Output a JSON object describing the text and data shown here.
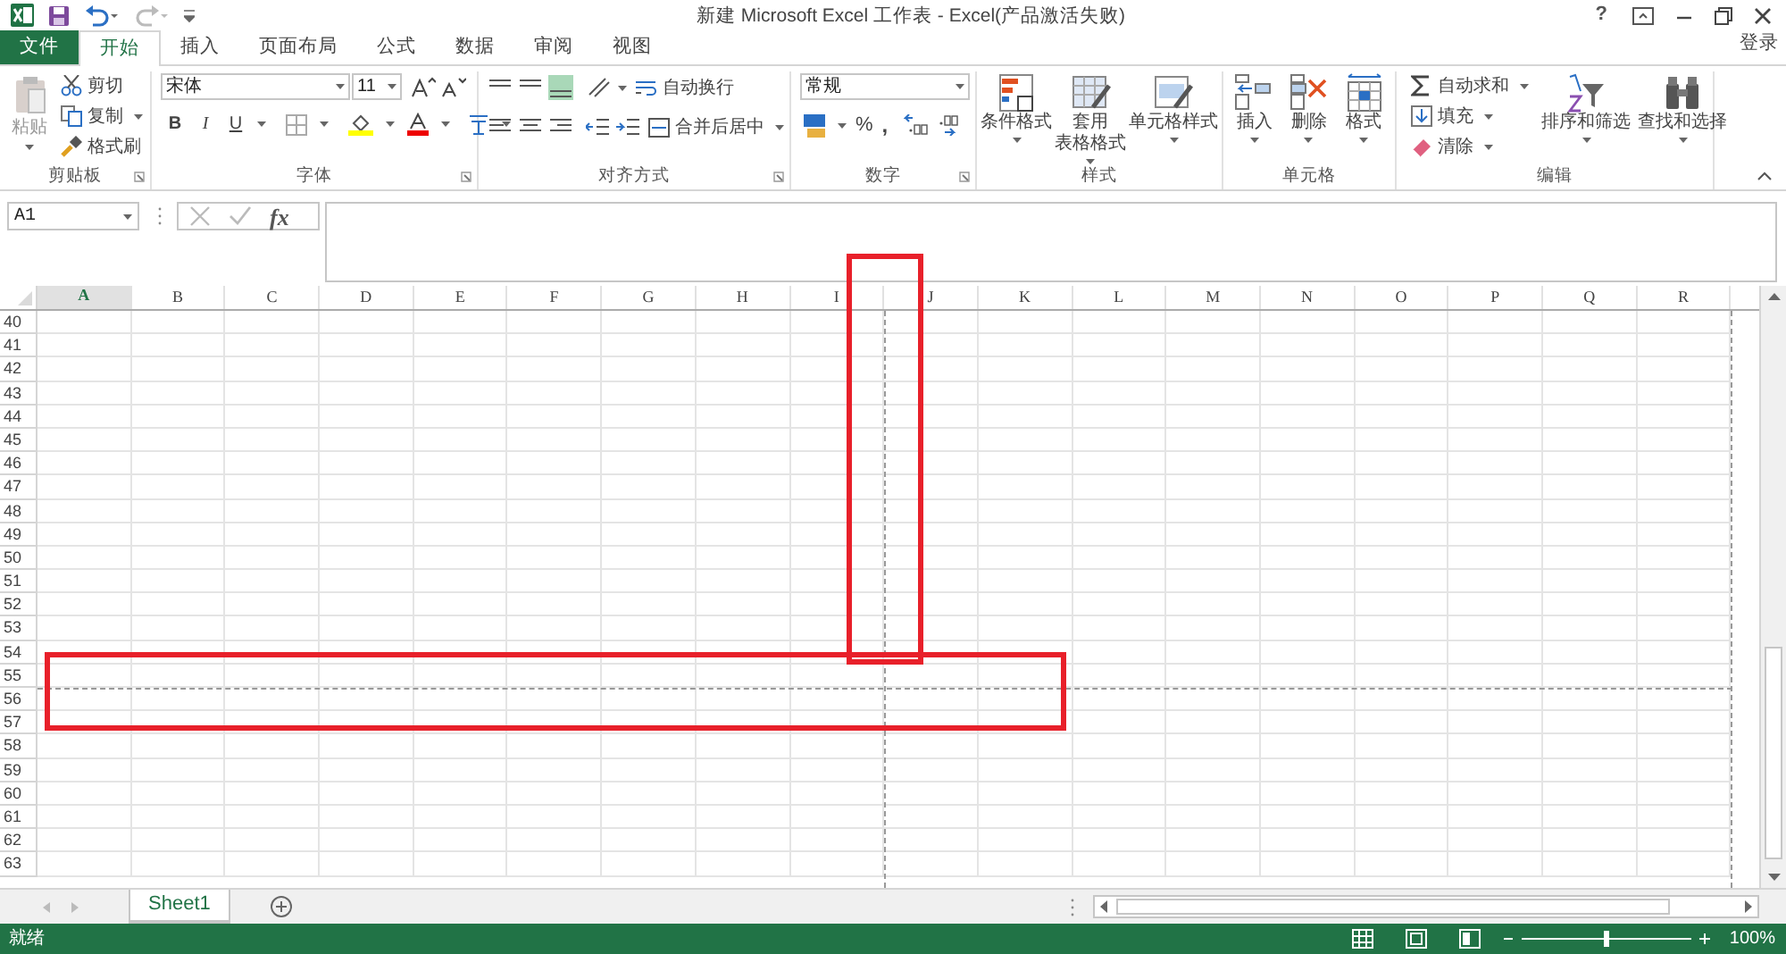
{
  "window": {
    "title": "新建 Microsoft Excel 工作表 - Excel(产品激活失败)",
    "help": "?",
    "sign_in": "登录"
  },
  "tabs": [
    {
      "label": "文件",
      "kind": "file",
      "selected": false
    },
    {
      "label": "开始",
      "kind": "tab",
      "selected": true
    },
    {
      "label": "插入",
      "kind": "tab",
      "selected": false
    },
    {
      "label": "页面布局",
      "kind": "tab",
      "selected": false
    },
    {
      "label": "公式",
      "kind": "tab",
      "selected": false
    },
    {
      "label": "数据",
      "kind": "tab",
      "selected": false
    },
    {
      "label": "审阅",
      "kind": "tab",
      "selected": false
    },
    {
      "label": "视图",
      "kind": "tab",
      "selected": false
    }
  ],
  "ribbon": {
    "clipboard": {
      "label": "剪贴板",
      "paste": "粘贴",
      "items": [
        "剪切",
        "复制",
        "格式刷"
      ]
    },
    "font": {
      "label": "字体",
      "font_name": "宋体",
      "font_size": "11",
      "styles": [
        "B",
        "I",
        "U"
      ]
    },
    "alignment": {
      "label": "对齐方式",
      "wrap": "自动换行",
      "merge": "合并后居中"
    },
    "number": {
      "label": "数字",
      "format": "常规",
      "percent": "%",
      "comma": ","
    },
    "styles": {
      "label": "样式",
      "buttons": [
        [
          "条件格式"
        ],
        [
          "套用",
          "表格格式"
        ],
        [
          "单元格样式"
        ]
      ]
    },
    "cells": {
      "label": "单元格",
      "buttons": [
        "插入",
        "删除",
        "格式"
      ]
    },
    "editing": {
      "label": "编辑",
      "items": [
        "自动求和",
        "填充",
        "清除"
      ],
      "buttons": [
        "排序和筛选",
        "查找和选择"
      ]
    }
  },
  "formula_bar": {
    "name_box": "A1",
    "fx": "fx"
  },
  "columns": [
    {
      "label": "A",
      "selected": true
    },
    {
      "label": "B",
      "selected": false
    },
    {
      "label": "C",
      "selected": false
    },
    {
      "label": "D",
      "selected": false
    },
    {
      "label": "E",
      "selected": false
    },
    {
      "label": "F",
      "selected": false
    },
    {
      "label": "G",
      "selected": false
    },
    {
      "label": "H",
      "selected": false
    },
    {
      "label": "I",
      "selected": false
    },
    {
      "label": "J",
      "selected": false
    },
    {
      "label": "K",
      "selected": false
    },
    {
      "label": "L",
      "selected": false
    },
    {
      "label": "M",
      "selected": false
    },
    {
      "label": "N",
      "selected": false
    },
    {
      "label": "O",
      "selected": false
    },
    {
      "label": "P",
      "selected": false
    },
    {
      "label": "Q",
      "selected": false
    },
    {
      "label": "R",
      "selected": false
    }
  ],
  "rows": [
    "40",
    "41",
    "42",
    "43",
    "44",
    "45",
    "46",
    "47",
    "48",
    "49",
    "50",
    "51",
    "52",
    "53",
    "54",
    "55",
    "56",
    "57",
    "58",
    "59",
    "60",
    "61",
    "62",
    "63"
  ],
  "page_breaks": [
    {
      "kind": "vertical",
      "highlighted": true
    },
    {
      "kind": "horizontal",
      "highlighted": true
    }
  ],
  "sheet_tabs": [
    {
      "label": "Sheet1",
      "selected": true
    }
  ],
  "status_bar": {
    "status": "就绪",
    "zoom": "100%",
    "zoom_level": {
      "level": 0.5
    }
  }
}
